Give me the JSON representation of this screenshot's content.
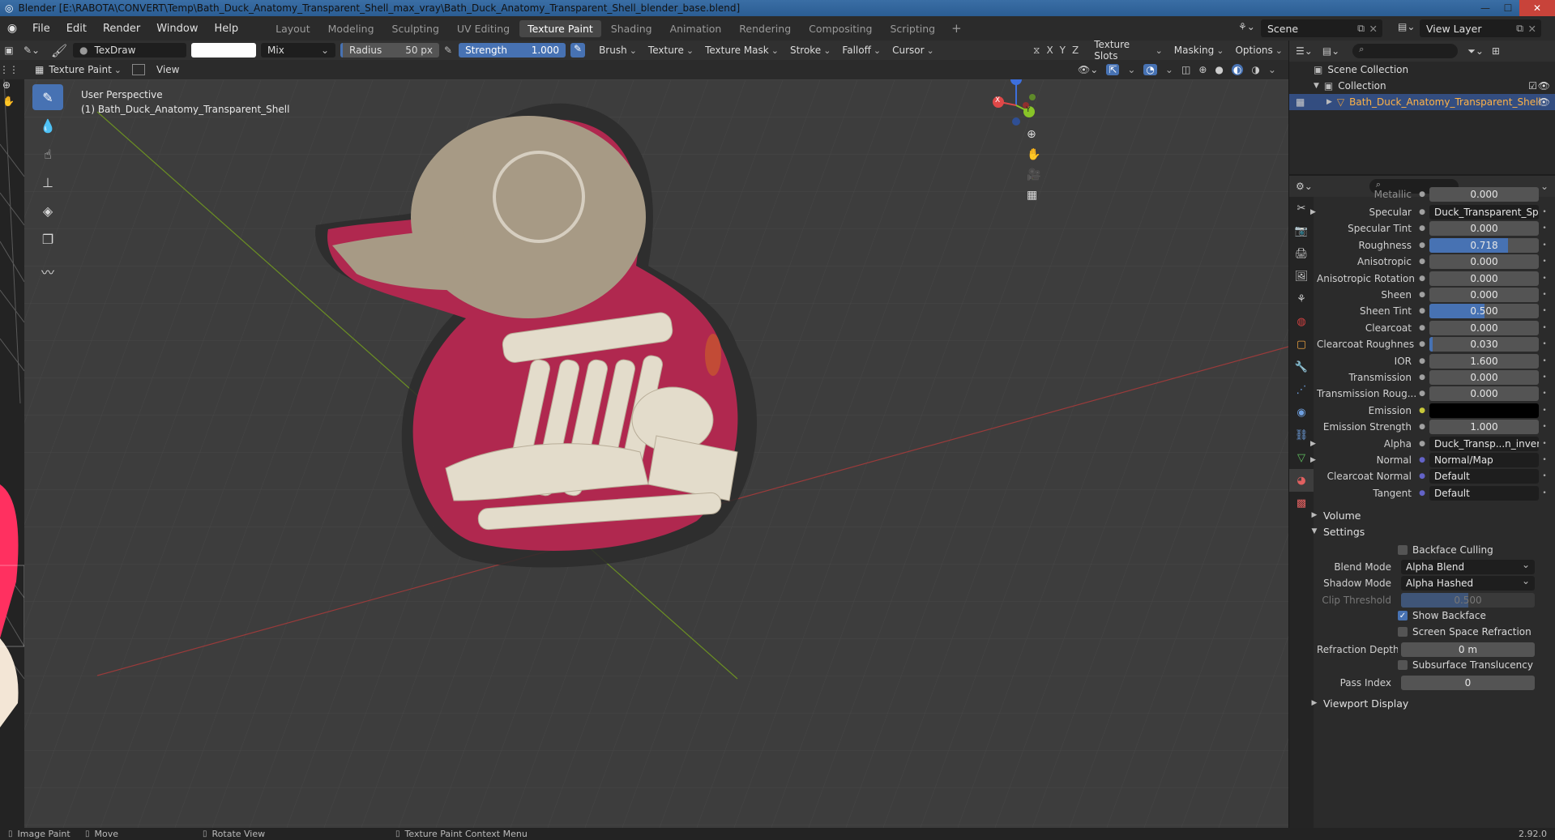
{
  "window": {
    "title": "Blender [E:\\RABOTA\\CONVERT\\Temp\\Bath_Duck_Anatomy_Transparent_Shell_max_vray\\Bath_Duck_Anatomy_Transparent_Shell_blender_base.blend]",
    "min": "—",
    "max": "☐",
    "close": "✕"
  },
  "menu": [
    "File",
    "Edit",
    "Render",
    "Window",
    "Help"
  ],
  "workspaces": [
    "Layout",
    "Modeling",
    "Sculpting",
    "UV Editing",
    "Texture Paint",
    "Shading",
    "Animation",
    "Rendering",
    "Compositing",
    "Scripting"
  ],
  "workspace_add": "+",
  "scene": {
    "name": "Scene",
    "view_layer": "View Layer"
  },
  "tool_header": {
    "brush_name": "TexDraw",
    "blend": "Mix",
    "radius_label": "Radius",
    "radius_value": "50 px",
    "strength_label": "Strength",
    "strength_value": "1.000",
    "menus": [
      "Brush",
      "Texture",
      "Texture Mask",
      "Stroke",
      "Falloff",
      "Cursor"
    ],
    "axes": [
      "X",
      "Y",
      "Z"
    ],
    "right_menus": [
      "Texture Slots",
      "Masking",
      "Options"
    ]
  },
  "viewport_header": {
    "mode": "Texture Paint",
    "view": "View"
  },
  "viewport": {
    "perspective": "User Perspective",
    "object_info": "(1) Bath_Duck_Anatomy_Transparent_Shell",
    "gizmo": {
      "x": "X",
      "y": "Y",
      "z": "Z"
    }
  },
  "outliner": {
    "scene_collection": "Scene Collection",
    "collection": "Collection",
    "object": "Bath_Duck_Anatomy_Transparent_Shell"
  },
  "properties": {
    "cut_label": "Metallic",
    "cut_value": "0.000",
    "rows": [
      {
        "label": "Specular",
        "type": "text",
        "value": "Duck_Transparent_Specul...",
        "expand": true
      },
      {
        "label": "Specular Tint",
        "value": "0.000",
        "fill": 0
      },
      {
        "label": "Roughness",
        "value": "0.718",
        "fill": 0.718
      },
      {
        "label": "Anisotropic",
        "value": "0.000",
        "fill": 0
      },
      {
        "label": "Anisotropic Rotation",
        "value": "0.000",
        "fill": 0
      },
      {
        "label": "Sheen",
        "value": "0.000",
        "fill": 0
      },
      {
        "label": "Sheen Tint",
        "value": "0.500",
        "fill": 0.5
      },
      {
        "label": "Clearcoat",
        "value": "0.000",
        "fill": 0
      },
      {
        "label": "Clearcoat Roughnes",
        "value": "0.030",
        "fill": 0.03
      },
      {
        "label": "IOR",
        "value": "1.600",
        "fill": 0
      },
      {
        "label": "Transmission",
        "value": "0.000",
        "fill": 0
      },
      {
        "label": "Transmission Roug...",
        "value": "0.000",
        "fill": 0
      },
      {
        "label": "Emission",
        "type": "color",
        "value": "",
        "dot_color": "#c8c83a"
      },
      {
        "label": "Emission Strength",
        "value": "1.000",
        "fill": 0
      },
      {
        "label": "Alpha",
        "type": "text",
        "value": "Duck_Transp...n_invert.png",
        "expand": true
      },
      {
        "label": "Normal",
        "type": "text",
        "value": "Normal/Map",
        "expand": true,
        "dot_color": "#6363c7"
      },
      {
        "label": "Clearcoat Normal",
        "type": "text",
        "value": "Default",
        "dot_color": "#6363c7"
      },
      {
        "label": "Tangent",
        "type": "text",
        "value": "Default",
        "dot_color": "#6363c7"
      }
    ],
    "volume": "Volume",
    "settings": "Settings",
    "backface_culling": "Backface Culling",
    "blend_mode_label": "Blend Mode",
    "blend_mode": "Alpha Blend",
    "shadow_mode_label": "Shadow Mode",
    "shadow_mode": "Alpha Hashed",
    "clip_threshold_label": "Clip Threshold",
    "clip_threshold": "0.500",
    "show_backface": "Show Backface",
    "screen_space_refraction": "Screen Space Refraction",
    "refraction_depth_label": "Refraction Depth",
    "refraction_depth": "0 m",
    "subsurface_translucency": "Subsurface Translucency",
    "pass_index_label": "Pass Index",
    "pass_index": "0",
    "viewport_display": "Viewport Display"
  },
  "status": {
    "image_paint": "Image Paint",
    "move": "Move",
    "rotate_view": "Rotate View",
    "context_menu": "Texture Paint Context Menu",
    "version": "2.92.0"
  },
  "colors": {
    "accent": "#4772b3",
    "selected_row": "#334d80",
    "duck_shell": "#b0284f",
    "bone": "#e3dccb"
  }
}
